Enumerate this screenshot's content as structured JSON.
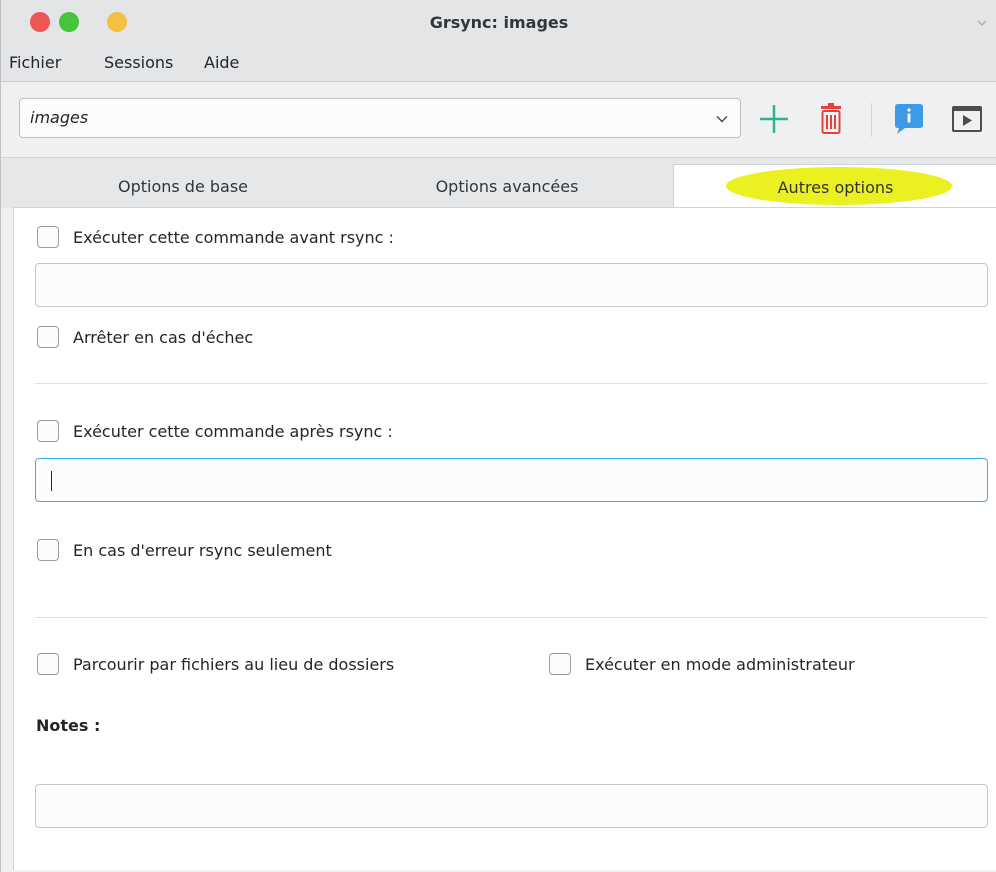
{
  "window": {
    "title": "Grsync: images"
  },
  "menu": {
    "items": [
      "Fichier",
      "Sessions",
      "Aide"
    ]
  },
  "toolbar": {
    "session_value": "images",
    "icons": [
      "add-icon",
      "delete-icon",
      "info-icon",
      "run-icon"
    ]
  },
  "tabs": [
    {
      "label": "Options de base",
      "active": false
    },
    {
      "label": "Options avancées",
      "active": false
    },
    {
      "label": "Autres options",
      "active": true
    }
  ],
  "other_options": {
    "pre_command": {
      "label": "Exécuter cette commande avant rsync :",
      "checked": false,
      "value": ""
    },
    "stop_on_failure": {
      "label": "Arrêter en cas d'échec",
      "checked": false
    },
    "post_command": {
      "label": "Exécuter cette commande après rsync :",
      "checked": false,
      "value": ""
    },
    "only_on_error": {
      "label": "En cas d'erreur rsync seulement",
      "checked": false
    },
    "browse_files": {
      "label": "Parcourir par fichiers au lieu de dossiers",
      "checked": false
    },
    "run_as_admin": {
      "label": "Exécuter en mode administrateur",
      "checked": false
    },
    "notes": {
      "label": "Notes :",
      "value": ""
    }
  },
  "colors": {
    "tab_highlight": "#ebf020",
    "add_green": "#2bb58a",
    "delete_red": "#e8403a",
    "info_blue": "#3d9ae8",
    "focus_blue": "#3daee9"
  }
}
